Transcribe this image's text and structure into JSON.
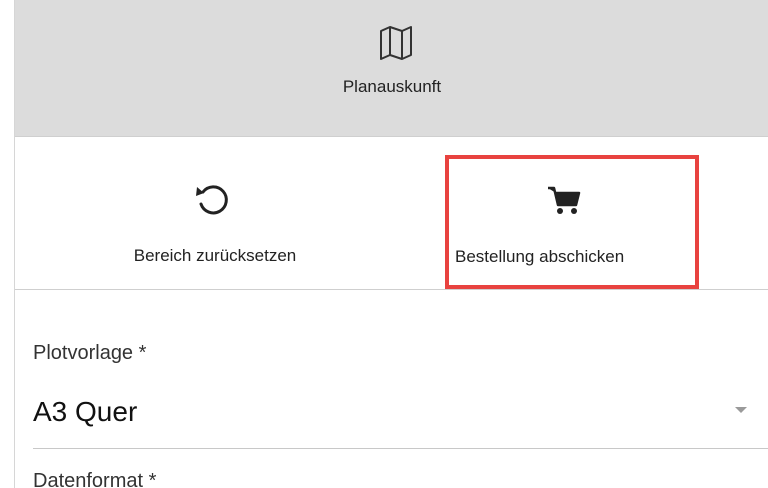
{
  "header": {
    "icon": "map-icon",
    "title": "Planauskunft"
  },
  "actions": {
    "reset": {
      "icon": "reset-icon",
      "label": "Bereich zurücksetzen"
    },
    "order": {
      "icon": "cart-icon",
      "label": "Bestellung abschicken",
      "highlight_color": "#e8423f"
    }
  },
  "form": {
    "plot_template": {
      "label": "Plotvorlage *",
      "value": "A3 Quer"
    },
    "data_format": {
      "label": "Datenformat *"
    }
  }
}
